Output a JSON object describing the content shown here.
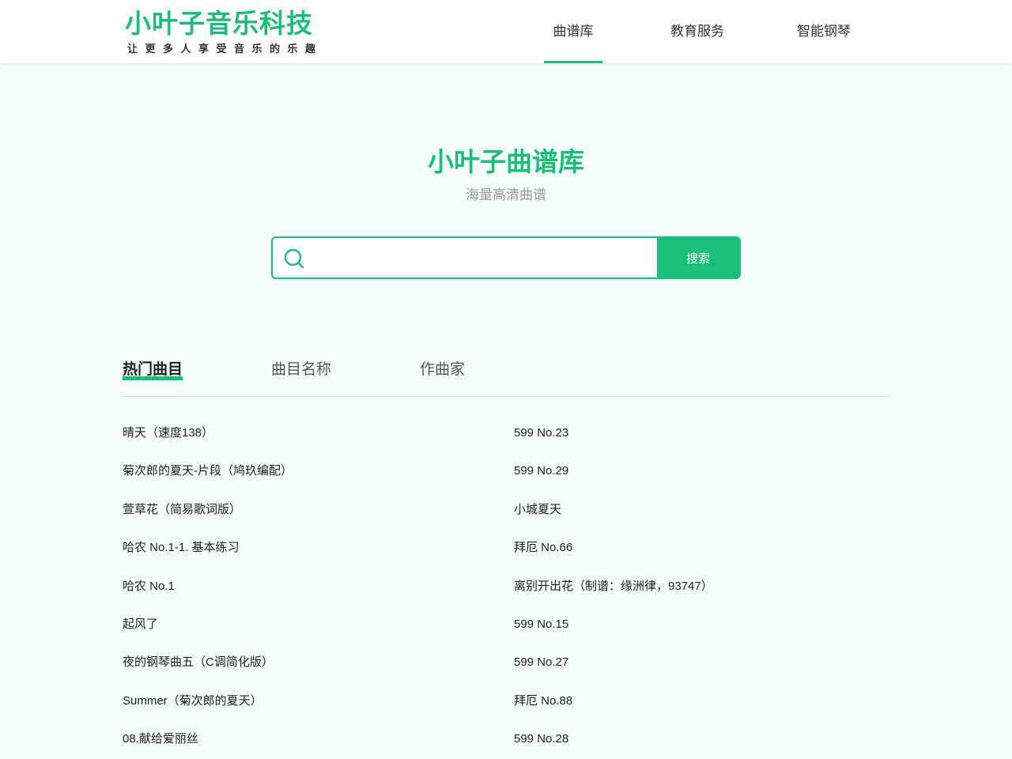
{
  "header": {
    "logo_title": "小叶子音乐科技",
    "logo_slogan": "让更多人享受音乐的乐趣",
    "nav": [
      {
        "label": "曲谱库",
        "active": true
      },
      {
        "label": "教育服务",
        "active": false
      },
      {
        "label": "智能钢琴",
        "active": false
      }
    ]
  },
  "hero": {
    "title": "小叶子曲谱库",
    "subtitle": "海量高清曲谱"
  },
  "search": {
    "placeholder": "",
    "value": "",
    "button_label": "搜索",
    "icon": "search-icon"
  },
  "tabs": [
    {
      "label": "热门曲目",
      "active": true
    },
    {
      "label": "曲目名称",
      "active": false
    },
    {
      "label": "作曲家",
      "active": false
    }
  ],
  "songs": {
    "left": [
      "晴天（速度138）",
      "菊次郎的夏天-片段（鸠玖编配）",
      "萱草花（简易歌词版）",
      "哈农 No.1-1. 基本练习",
      "哈农 No.1",
      "起风了",
      "夜的钢琴曲五（C调简化版）",
      "Summer（菊次郎的夏天）",
      "08.献给爱丽丝"
    ],
    "right": [
      "599 No.23",
      "599 No.29",
      "小城夏天",
      "拜厄 No.66",
      "离别开出花（制谱：缘洲律，93747）",
      "599 No.15",
      "599 No.27",
      "拜厄 No.88",
      "599 No.28"
    ]
  },
  "colors": {
    "brand": "#1bbd78",
    "background": "#f4fdf9",
    "subtitle": "#9a9a9a"
  }
}
